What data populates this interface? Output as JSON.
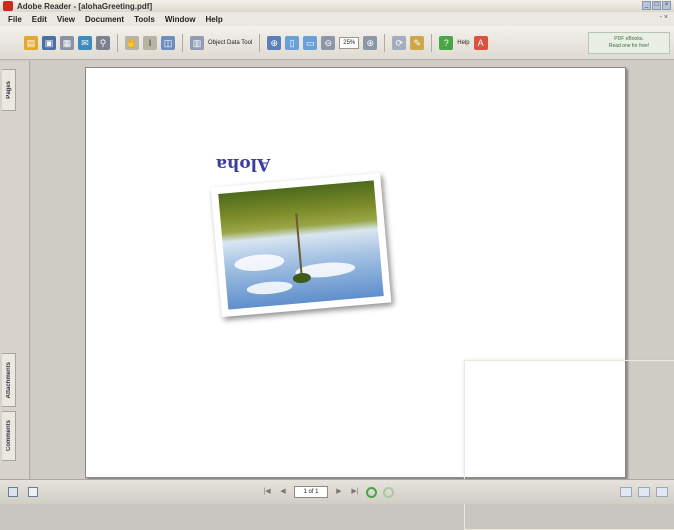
{
  "window": {
    "title": "Adobe Reader - [alohaGreeting.pdf]",
    "controls": [
      "_",
      "□",
      "×"
    ]
  },
  "menubar": {
    "items": [
      "File",
      "Edit",
      "View",
      "Document",
      "Tools",
      "Window",
      "Help"
    ],
    "doc_controls": "- ×"
  },
  "toolbar": {
    "object_data_tool_label": "Object Data Tool",
    "zoom_value": "25%",
    "help_label": "Help",
    "ad_text_1": "PDF eBooks.",
    "ad_text_2": "Read one for free!"
  },
  "sidebar": {
    "tabs": [
      "Pages",
      "Attachments",
      "Comments"
    ]
  },
  "document": {
    "heading": "Aloha"
  },
  "statusbar": {
    "page_indicator": "1 of 1"
  }
}
